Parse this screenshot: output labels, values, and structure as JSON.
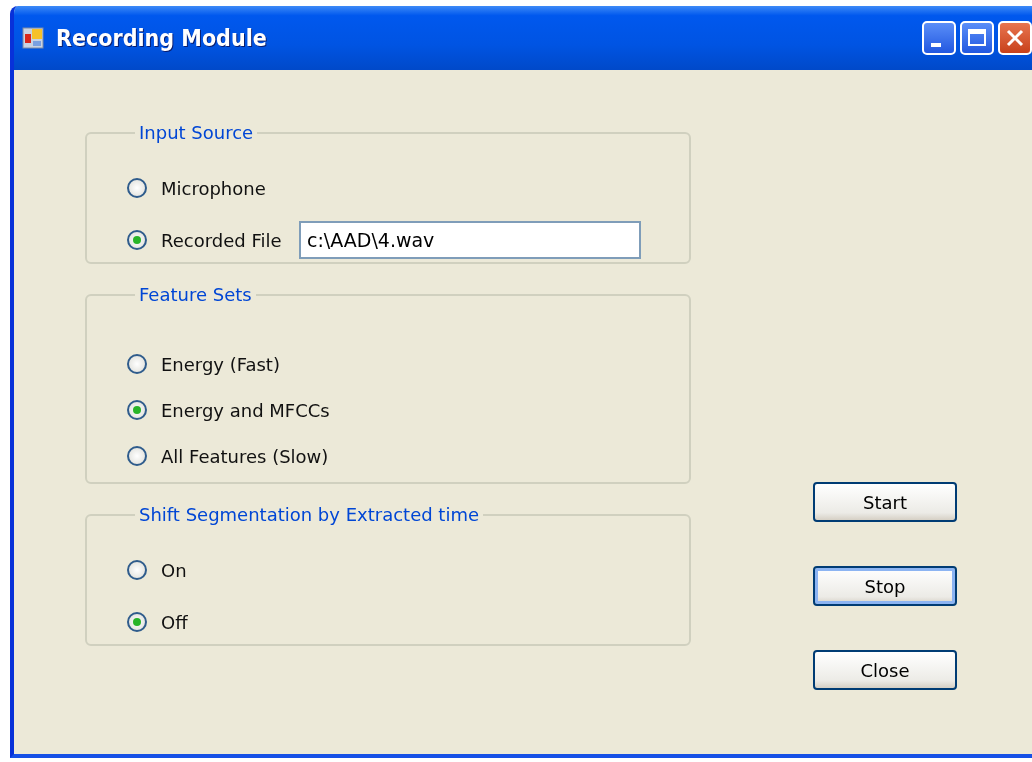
{
  "window": {
    "title": "Recording Module"
  },
  "groups": [
    {
      "title": "Input Source",
      "options": [
        {
          "label": "Microphone",
          "selected": false
        },
        {
          "label": "Recorded File",
          "selected": true,
          "field": {
            "value": "c:\\AAD\\4.wav"
          }
        }
      ]
    },
    {
      "title": "Feature Sets",
      "options": [
        {
          "label": "Energy (Fast)",
          "selected": false
        },
        {
          "label": "Energy and MFCCs",
          "selected": true
        },
        {
          "label": "All Features (Slow)",
          "selected": false
        }
      ]
    },
    {
      "title": "Shift Segmentation by Extracted time",
      "options": [
        {
          "label": "On",
          "selected": false
        },
        {
          "label": "Off",
          "selected": true
        }
      ]
    }
  ],
  "buttons": [
    {
      "label": "Start",
      "focused": false
    },
    {
      "label": "Stop",
      "focused": true
    },
    {
      "label": "Close",
      "focused": false
    }
  ]
}
